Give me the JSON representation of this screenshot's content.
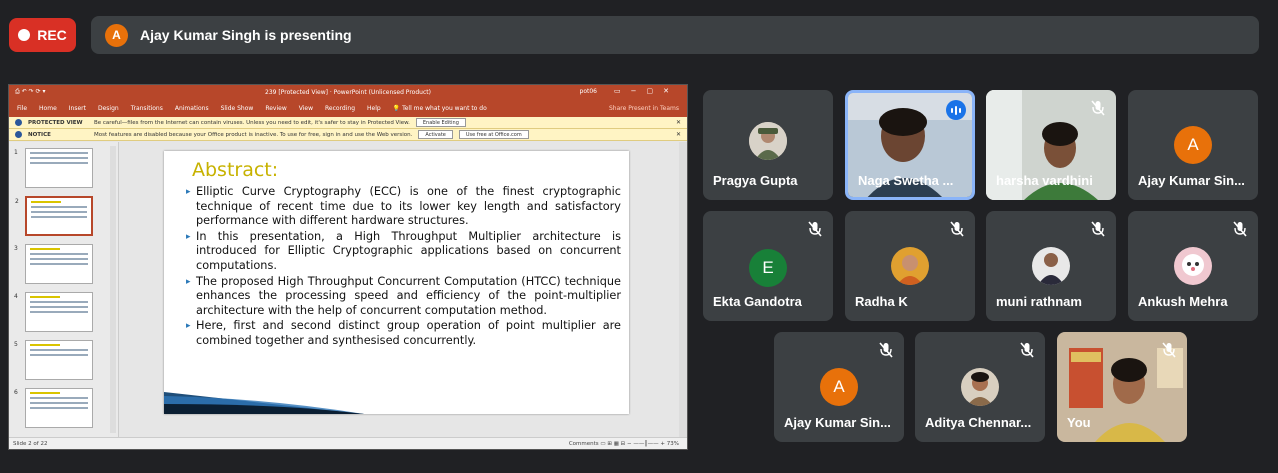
{
  "topbar": {
    "rec_label": "REC",
    "presenter_initial": "A",
    "presenting_text": "Ajay Kumar Singh is presenting"
  },
  "ppt": {
    "window_title": "239 [Protected View]  ·  PowerPoint (Unlicensed Product)",
    "quick_access": "⎙  ↶  ↷  ⟳  ▾",
    "account": "pot06",
    "ribbon_tabs": [
      "File",
      "Home",
      "Insert",
      "Design",
      "Transitions",
      "Animations",
      "Slide Show",
      "Review",
      "View",
      "Recording",
      "Help",
      "💡 Tell me what you want to do"
    ],
    "ribbon_right": "Share   Present in Teams",
    "protected": {
      "label": "PROTECTED VIEW",
      "text": "Be careful—files from the Internet can contain viruses. Unless you need to edit, it's safer to stay in Protected View.",
      "button": "Enable Editing"
    },
    "notice": {
      "label": "NOTICE",
      "text": "Most features are disabled because your Office product is inactive. To use for free, sign in and use the Web version.",
      "button1": "Activate",
      "button2": "Use free at Office.com"
    },
    "thumbnails": [
      1,
      2,
      3,
      4,
      5,
      6
    ],
    "slide": {
      "heading": "Abstract:",
      "bullets": [
        "Elliptic Curve Cryptography (ECC) is one of the finest cryptographic technique of recent time due to its lower key length and satisfactory performance with different hardware structures.",
        "In this presentation, a High Throughput Multiplier architecture is introduced for Elliptic Cryptographic applications based on concurrent computations.",
        "The proposed High Throughput Concurrent Computation (HTCC) technique enhances the processing speed and efficiency of the point-multiplier architecture with the help of concurrent computation method.",
        "Here, first and second distinct group operation of point multiplier are combined together and synthesised concurrently."
      ]
    },
    "status_left": "Slide 2 of 22",
    "status_right": "Comments    ▭  ⊞  ▦  ⊟   −  ——┃——  +  73%"
  },
  "tiles": [
    {
      "name": "Pragya Gupta",
      "kind": "photo",
      "muted": false
    },
    {
      "name": "Naga Swetha ...",
      "kind": "video",
      "muted": false,
      "speaking": true
    },
    {
      "name": "harsha vardhini",
      "kind": "video",
      "muted": true
    },
    {
      "name": "Ajay Kumar Sin...",
      "kind": "initial",
      "initial": "A",
      "color": "#e8710a",
      "muted": false
    },
    {
      "name": "Ekta Gandotra",
      "kind": "initial",
      "initial": "E",
      "color": "#188038",
      "muted": true
    },
    {
      "name": "Radha K",
      "kind": "photo",
      "muted": true
    },
    {
      "name": "muni rathnam",
      "kind": "photo",
      "muted": true
    },
    {
      "name": "Ankush Mehra",
      "kind": "photo",
      "muted": true
    },
    {
      "name": "Ajay Kumar Sin...",
      "kind": "initial",
      "initial": "A",
      "color": "#e8710a",
      "muted": true
    },
    {
      "name": "Aditya Chennar...",
      "kind": "photo",
      "muted": true
    },
    {
      "name": "You",
      "kind": "video",
      "muted": true
    }
  ]
}
